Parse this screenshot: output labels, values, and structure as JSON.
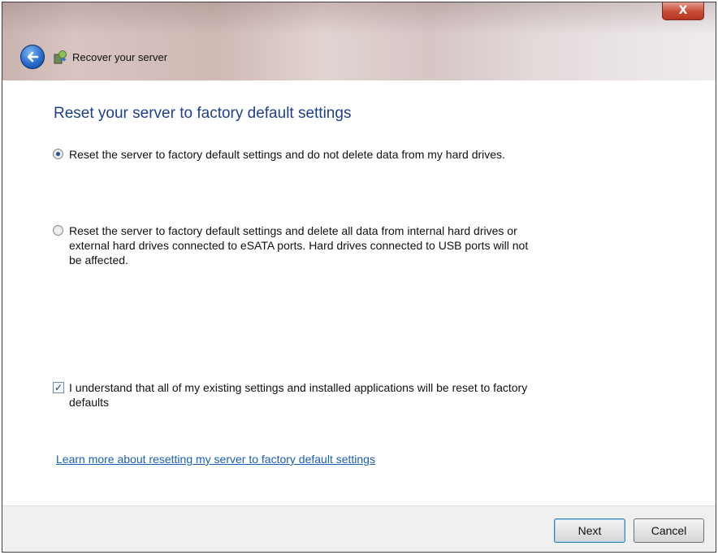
{
  "window": {
    "close_glyph": "X",
    "title": "Recover your server"
  },
  "icons": {
    "back": "back-arrow-icon",
    "app": "server-recovery-icon",
    "close": "close-icon"
  },
  "main": {
    "heading": "Reset your server to factory default settings",
    "options": [
      {
        "label": "Reset the server to factory default settings and do not delete data from my hard drives.",
        "selected": true
      },
      {
        "label_lines": [
          "Reset the server to factory default settings and delete all data from internal hard drives or",
          "external hard drives connected to eSATA ports. Hard drives connected to USB ports will not",
          "be affected."
        ],
        "selected": false
      }
    ],
    "confirm": {
      "label_lines": [
        "I understand that all of my existing settings and installed applications will be reset to factory",
        "defaults"
      ],
      "checked": true,
      "check_glyph": "✓"
    },
    "learn_more_link": "Learn more about resetting my server to factory default settings"
  },
  "footer": {
    "next_label": "Next",
    "cancel_label": "Cancel"
  },
  "colors": {
    "heading": "#1e3f8a",
    "link": "#1a5fb4",
    "close_button": "#c84b34"
  }
}
